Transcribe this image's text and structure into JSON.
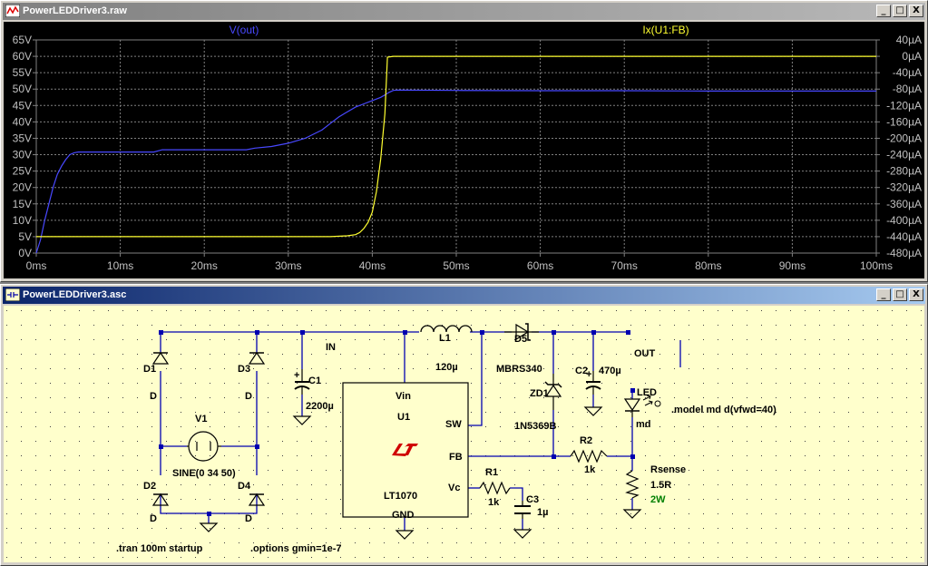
{
  "plot_window": {
    "title": "PowerLEDDriver3.raw",
    "traces": [
      "V(out)",
      "Ix(U1:FB)"
    ],
    "colors": {
      "left": "#4848ff",
      "right": "#ffff30"
    }
  },
  "schematic_window": {
    "title": "PowerLEDDriver3.asc"
  },
  "window_buttons": {
    "minimize": "_",
    "restore": "□",
    "close": "X"
  },
  "chart_data": {
    "type": "line",
    "title": "",
    "xlabel": "",
    "x_range_ms": [
      0,
      100
    ],
    "x_ticks": [
      "0ms",
      "10ms",
      "20ms",
      "30ms",
      "40ms",
      "50ms",
      "60ms",
      "70ms",
      "80ms",
      "90ms",
      "100ms"
    ],
    "left_axis": {
      "range": [
        0,
        65
      ],
      "ticks": [
        "0V",
        "5V",
        "10V",
        "15V",
        "20V",
        "25V",
        "30V",
        "35V",
        "40V",
        "45V",
        "50V",
        "55V",
        "60V",
        "65V"
      ]
    },
    "right_axis": {
      "range": [
        -480,
        40
      ],
      "ticks": [
        "40µA",
        "0µA",
        "-40µA",
        "-80µA",
        "-120µA",
        "-160µA",
        "-200µA",
        "-240µA",
        "-280µA",
        "-320µA",
        "-360µA",
        "-400µA",
        "-440µA",
        "-480µA"
      ]
    },
    "grid": true,
    "series": [
      {
        "name": "V(out)",
        "axis": "left",
        "x": [
          0,
          0.5,
          1,
          1.5,
          2,
          2.5,
          3,
          3.5,
          4,
          4.5,
          5,
          6,
          10,
          14,
          15,
          20,
          25,
          26,
          28,
          30,
          32,
          34,
          35,
          36,
          37,
          38,
          39,
          40,
          41,
          41.5,
          42,
          42.5,
          43,
          50,
          60,
          70,
          80,
          90,
          100
        ],
        "y": [
          0,
          4,
          10,
          15,
          20,
          24,
          26.5,
          28.5,
          30,
          30.6,
          30.8,
          30.8,
          30.8,
          30.8,
          31.5,
          31.5,
          31.5,
          32,
          32.5,
          33.5,
          35,
          37.5,
          39.5,
          41.5,
          43,
          44.5,
          45.5,
          46.5,
          47.5,
          48.2,
          49,
          49.6,
          49.7,
          49.6,
          49.5,
          49.5,
          49.4,
          49.4,
          49.4
        ]
      },
      {
        "name": "Ix(U1:FB)",
        "axis": "right",
        "x": [
          0,
          10,
          20,
          25.9,
          26,
          30,
          35,
          37,
          38,
          38.5,
          39,
          39.5,
          40,
          40.5,
          41,
          41.5,
          41.8,
          42.5,
          50,
          60,
          70,
          80,
          90,
          100
        ],
        "y": [
          -440,
          -440,
          -440,
          -440,
          -440,
          -440,
          -440,
          -438,
          -435,
          -430,
          -420,
          -405,
          -380,
          -330,
          -250,
          -140,
          -2,
          0,
          0,
          0,
          0,
          0,
          0,
          0
        ]
      }
    ]
  },
  "schematic": {
    "labels": {
      "net_in": "IN",
      "net_out": "OUT",
      "d1": "D1",
      "d2": "D2",
      "d3": "D3",
      "d4": "D4",
      "diode_type": "D",
      "v1": "V1",
      "v1_value": "SINE(0 34 50)",
      "c1": "C1",
      "c1_value": "2200µ",
      "u1": "U1",
      "u1_part": "LT1070",
      "pin_vin": "Vin",
      "pin_sw": "SW",
      "pin_fb": "FB",
      "pin_vc": "Vc",
      "pin_gnd": "GND",
      "l1": "L1",
      "l1_value": "120µ",
      "d5": "D5",
      "d5_part": "MBRS340",
      "zd1": "ZD1",
      "zd1_part": "1N5369B",
      "c2": "C2",
      "c2_value": "470µ",
      "led": "LED",
      "led_model": "md",
      "model_directive": ".model md d(vfwd=40)",
      "r2": "R2",
      "r2_value": "1k",
      "rsense": "Rsense",
      "rsense_value": "1.5R",
      "rsense_power": "2W",
      "r1": "R1",
      "r1_value": "1k",
      "c3": "C3",
      "c3_value": "1µ",
      "tran_directive": ".tran 100m startup",
      "options_directive": ".options gmin=1e-7"
    }
  }
}
